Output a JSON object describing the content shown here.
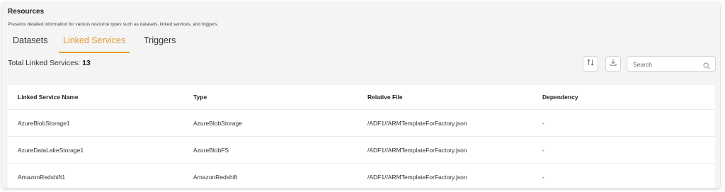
{
  "header": {
    "title": "Resources",
    "description": "Presents detailed information for various resource types such as datasets, linked services, and triggers."
  },
  "tabs": [
    {
      "label": "Datasets",
      "active": false
    },
    {
      "label": "Linked Services",
      "active": true
    },
    {
      "label": "Triggers",
      "active": false
    }
  ],
  "summary": {
    "label": "Total Linked Services: ",
    "count": "13"
  },
  "toolbar": {
    "sort_icon": "sort-arrows-icon",
    "download_icon": "download-icon",
    "search_placeholder": "Search",
    "search_value": "",
    "search_icon": "search-icon"
  },
  "table": {
    "columns": [
      "Linked Service Name",
      "Type",
      "Relative File",
      "Dependency"
    ],
    "rows": [
      [
        "AzureBlobStorage1",
        "AzureBlobStorage",
        "/ADF1//ARMTemplateForFactory.json",
        "-"
      ],
      [
        "AzureDataLakeStorage1",
        "AzureBlobFS",
        "/ADF1//ARMTemplateForFactory.json",
        "-"
      ],
      [
        "AmazonRedshift1",
        "AmazonRedshift",
        "/ADF1//ARMTemplateForFactory.json",
        "-"
      ]
    ]
  },
  "colors": {
    "accent": "#e59a2a",
    "panel_bg": "#f4f4f5",
    "table_bg": "#ffffff"
  }
}
